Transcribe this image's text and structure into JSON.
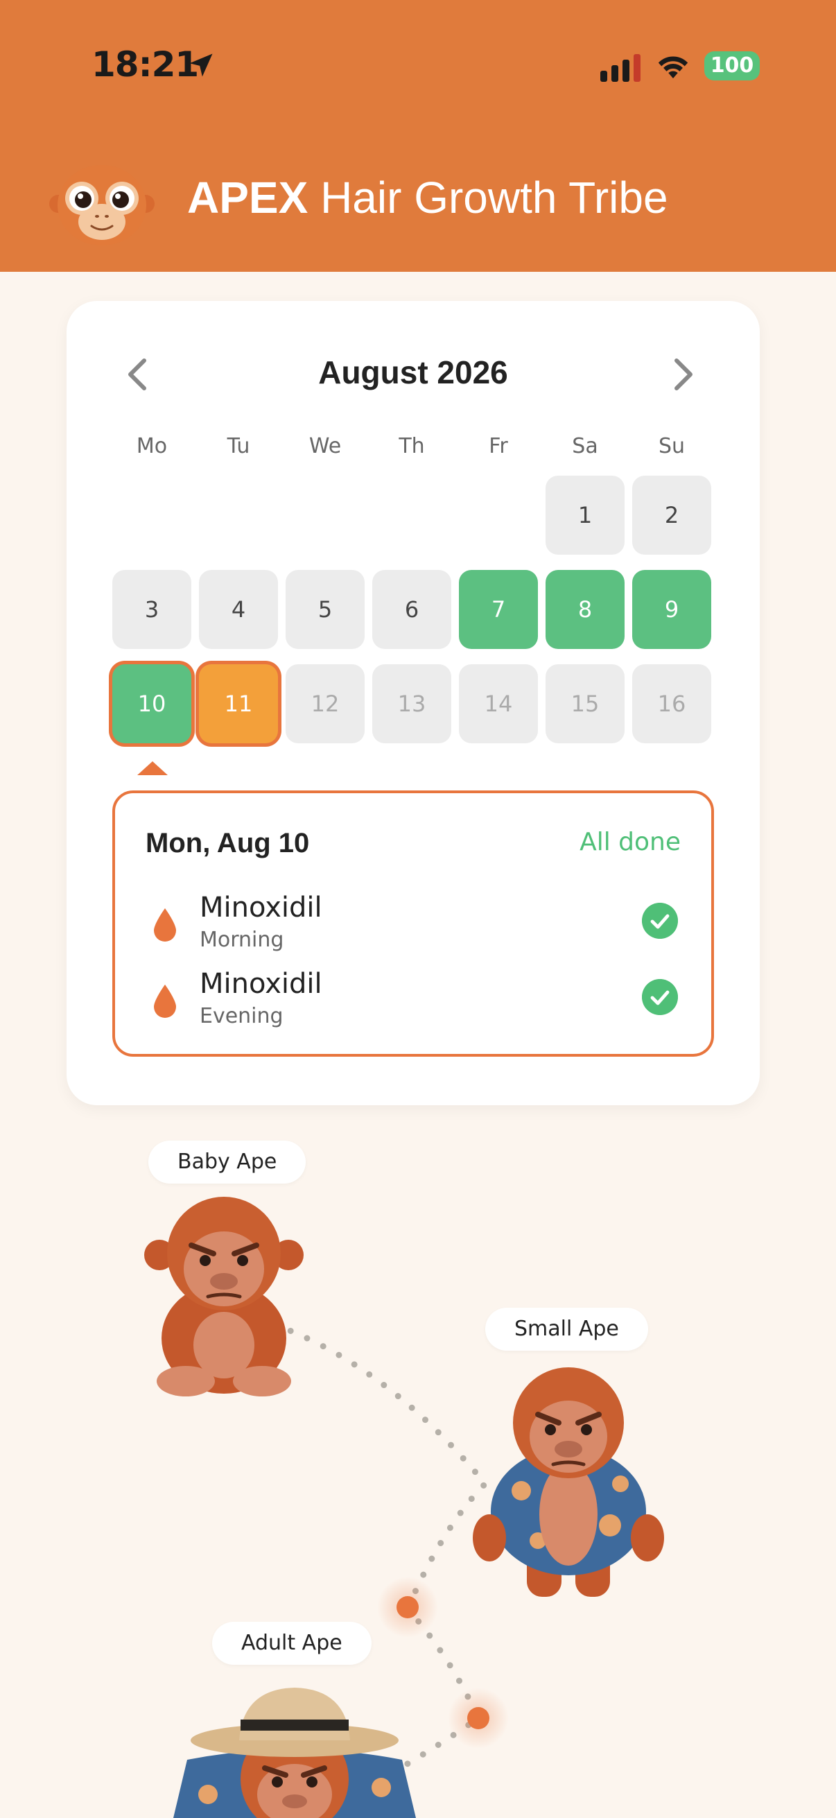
{
  "status_bar": {
    "time": "18:21",
    "battery": "100"
  },
  "header": {
    "title_bold": "APEX",
    "title_rest": " Hair Growth Tribe"
  },
  "calendar": {
    "month_label": "August 2026",
    "weekdays": [
      "Mo",
      "Tu",
      "We",
      "Th",
      "Fr",
      "Sa",
      "Su"
    ],
    "days": [
      {
        "label": "1",
        "state": "past"
      },
      {
        "label": "2",
        "state": "past"
      },
      {
        "label": "3",
        "state": "past"
      },
      {
        "label": "4",
        "state": "past"
      },
      {
        "label": "5",
        "state": "past"
      },
      {
        "label": "6",
        "state": "past"
      },
      {
        "label": "7",
        "state": "done"
      },
      {
        "label": "8",
        "state": "done"
      },
      {
        "label": "9",
        "state": "done"
      },
      {
        "label": "10",
        "state": "selected"
      },
      {
        "label": "11",
        "state": "today"
      },
      {
        "label": "12",
        "state": "future"
      },
      {
        "label": "13",
        "state": "future"
      },
      {
        "label": "14",
        "state": "future"
      },
      {
        "label": "15",
        "state": "future"
      },
      {
        "label": "16",
        "state": "future"
      }
    ],
    "colors": {
      "done": "#5cc081",
      "today": "#f3a03a",
      "accent": "#e8753d"
    }
  },
  "detail": {
    "date": "Mon, Aug 10",
    "status": "All done",
    "items": [
      {
        "name": "Minoxidil",
        "time": "Morning"
      },
      {
        "name": "Minoxidil",
        "time": "Evening"
      }
    ]
  },
  "evolution": {
    "stages": [
      "Baby Ape",
      "Small Ape",
      "Adult Ape"
    ]
  }
}
